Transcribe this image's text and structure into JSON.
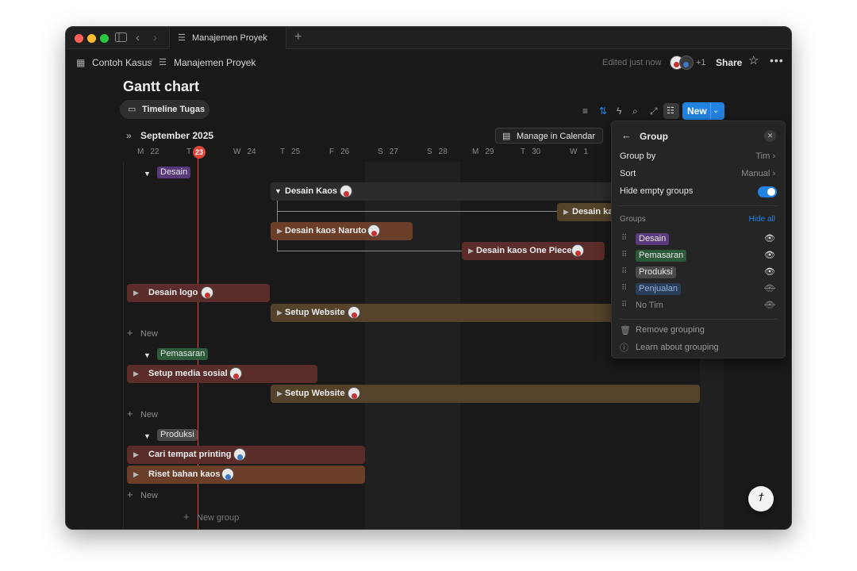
{
  "tab": {
    "title": "Manajemen Proyek"
  },
  "breadcrumb": {
    "workspace": "Contoh Kasus",
    "page": "Manajemen Proyek"
  },
  "topbar": {
    "edited": "Edited just now",
    "extra_users": "+1",
    "share": "Share"
  },
  "page": {
    "title": "Gantt chart",
    "view_tab": "Timeline Tugas"
  },
  "toolbar": {
    "new_label": "New"
  },
  "timeline": {
    "month": "September 2025",
    "manage_calendar": "Manage in Calendar",
    "days": [
      {
        "dow": "M",
        "num": "22"
      },
      {
        "dow": "T",
        "num": "23"
      },
      {
        "dow": "W",
        "num": "24"
      },
      {
        "dow": "T",
        "num": "25"
      },
      {
        "dow": "F",
        "num": "26"
      },
      {
        "dow": "S",
        "num": "27"
      },
      {
        "dow": "S",
        "num": "28"
      },
      {
        "dow": "M",
        "num": "29"
      },
      {
        "dow": "T",
        "num": "30"
      },
      {
        "dow": "W",
        "num": "1"
      }
    ],
    "today": "23"
  },
  "groups": [
    {
      "name": "Desain",
      "color": "#5a3a7a",
      "items": [
        {
          "label": "Desain Kaos",
          "type": "parent"
        },
        {
          "label": "Desain ka",
          "color": "#54432a"
        },
        {
          "label": "Desain kaos Naruto",
          "color": "#6a3e28"
        },
        {
          "label": "Desain kaos One Piece",
          "color": "#5a2c2a"
        },
        {
          "label": "Desain logo",
          "color": "#5a2c2a"
        },
        {
          "label": "Setup Website",
          "color": "#54432a"
        }
      ],
      "new_label": "New"
    },
    {
      "name": "Pemasaran",
      "color": "#2c5a3a",
      "items": [
        {
          "label": "Setup media sosial",
          "color": "#5a2c2a"
        },
        {
          "label": "Setup Website",
          "color": "#54432a"
        }
      ],
      "new_label": "New"
    },
    {
      "name": "Produksi",
      "color": "#4a4a4a",
      "items": [
        {
          "label": "Cari tempat printing",
          "color": "#5a2c2a"
        },
        {
          "label": "Riset bahan kaos",
          "color": "#6a3e28"
        }
      ],
      "new_label": "New"
    }
  ],
  "new_group": "New group",
  "group_menu": {
    "title": "Group",
    "group_by_label": "Group by",
    "group_by_value": "Tim",
    "sort_label": "Sort",
    "sort_value": "Manual",
    "hide_empty_label": "Hide empty groups",
    "hide_empty_on": true,
    "groups_heading": "Groups",
    "hide_all": "Hide all",
    "group_list": [
      {
        "name": "Desain",
        "color": "#5a3a7a",
        "visible": true
      },
      {
        "name": "Pemasaran",
        "color": "#2c5a3a",
        "visible": true
      },
      {
        "name": "Produksi",
        "color": "#4a4a4a",
        "visible": true
      },
      {
        "name": "Penjualan",
        "color": "#2a3e5a",
        "visible": false
      },
      {
        "name": "No Tim",
        "color": "",
        "visible": false
      }
    ],
    "remove_grouping": "Remove grouping",
    "learn": "Learn about grouping"
  },
  "colors": {
    "accent": "#2383e2",
    "today": "#e0453a",
    "background": "#191919"
  }
}
